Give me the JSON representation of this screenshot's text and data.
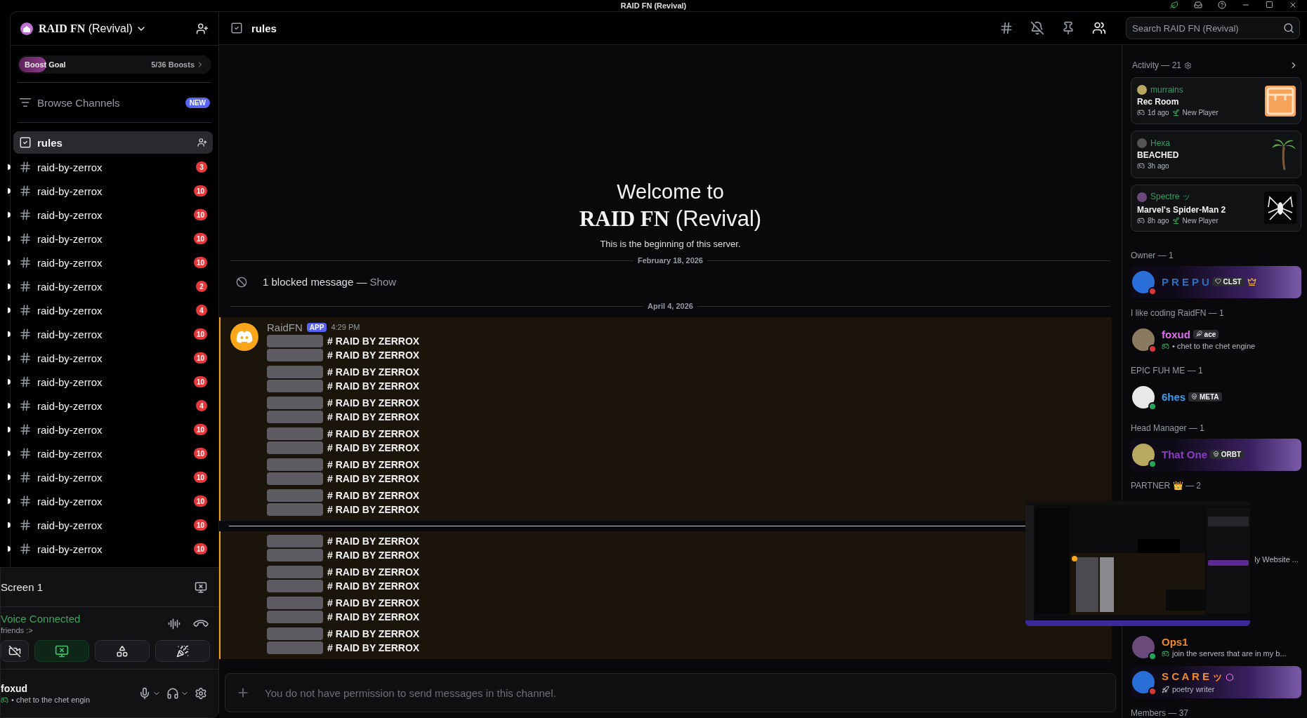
{
  "window": {
    "title": "RAID FN (Revival)"
  },
  "server": {
    "name": "**RAID FN** (Revival)",
    "boost": {
      "label": "Boost Goal",
      "count": "5/36 Boosts",
      "level": 0.14
    },
    "browse": {
      "label": "Browse Channels",
      "badge": "NEW"
    }
  },
  "channels": [
    {
      "kind": "rules",
      "name": "rules",
      "selected": true,
      "unread": false
    },
    {
      "kind": "text",
      "name": "raid-by-zerrox",
      "badge": "3",
      "selected": false,
      "unread": true
    },
    {
      "kind": "text",
      "name": "raid-by-zerrox",
      "badge": "10",
      "selected": false,
      "unread": true
    },
    {
      "kind": "text",
      "name": "raid-by-zerrox",
      "badge": "10",
      "selected": false,
      "unread": true
    },
    {
      "kind": "text",
      "name": "raid-by-zerrox",
      "badge": "10",
      "selected": false,
      "unread": true
    },
    {
      "kind": "text",
      "name": "raid-by-zerrox",
      "badge": "10",
      "selected": false,
      "unread": true
    },
    {
      "kind": "text",
      "name": "raid-by-zerrox",
      "badge": "2",
      "selected": false,
      "unread": true
    },
    {
      "kind": "text",
      "name": "raid-by-zerrox",
      "badge": "4",
      "selected": false,
      "unread": true
    },
    {
      "kind": "text",
      "name": "raid-by-zerrox",
      "badge": "10",
      "selected": false,
      "unread": true
    },
    {
      "kind": "text",
      "name": "raid-by-zerrox",
      "badge": "10",
      "selected": false,
      "unread": true
    },
    {
      "kind": "text",
      "name": "raid-by-zerrox",
      "badge": "10",
      "selected": false,
      "unread": true
    },
    {
      "kind": "text",
      "name": "raid-by-zerrox",
      "badge": "4",
      "selected": false,
      "unread": true
    },
    {
      "kind": "text",
      "name": "raid-by-zerrox",
      "badge": "10",
      "selected": false,
      "unread": true
    },
    {
      "kind": "text",
      "name": "raid-by-zerrox",
      "badge": "10",
      "selected": false,
      "unread": true
    },
    {
      "kind": "text",
      "name": "raid-by-zerrox",
      "badge": "10",
      "selected": false,
      "unread": true
    },
    {
      "kind": "text",
      "name": "raid-by-zerrox",
      "badge": "10",
      "selected": false,
      "unread": true
    },
    {
      "kind": "text",
      "name": "raid-by-zerrox",
      "badge": "10",
      "selected": false,
      "unread": true
    },
    {
      "kind": "text",
      "name": "raid-by-zerrox",
      "badge": "10",
      "selected": false,
      "unread": true
    }
  ],
  "voice": {
    "stream": "Screen 1",
    "status": "Voice Connected",
    "channel": "friends :>",
    "buttons": [
      {
        "kind": "camera",
        "on": false
      },
      {
        "kind": "screen",
        "on": true
      },
      {
        "kind": "activities",
        "on": false
      },
      {
        "kind": "soundboard",
        "on": false
      }
    ]
  },
  "user": {
    "name": "foxud",
    "status": "• chet to the chet engin"
  },
  "header": {
    "channel": "rules",
    "tools": [
      {
        "kind": "threads",
        "on": false
      },
      {
        "kind": "mute",
        "on": false
      },
      {
        "kind": "pins",
        "on": false
      },
      {
        "kind": "members",
        "on": true
      }
    ],
    "search": {
      "placeholder": "Search RAID FN (Revival)"
    }
  },
  "welcome": {
    "line1": "Welcome to",
    "line2": "**RAID FN** (Revival)",
    "subtitle": "This is the beginning of this server."
  },
  "dates": [
    "February 18, 2026",
    "April 4, 2026"
  ],
  "blocked": {
    "text": "1 blocked message —",
    "link": "Show"
  },
  "message": {
    "author": "RaidFN",
    "tag": "APP",
    "time": "4:29 PM",
    "lines": [
      "# RAID BY ZERROX",
      "# RAID BY ZERROX",
      "# RAID BY ZERROX",
      "# RAID BY ZERROX",
      "# RAID BY ZERROX",
      "# RAID BY ZERROX",
      "# RAID BY ZERROX",
      "# RAID BY ZERROX",
      "# RAID BY ZERROX",
      "# RAID BY ZERROX",
      "# RAID BY ZERROX",
      "# RAID BY ZERROX"
    ],
    "more_lines": [
      "# RAID BY ZERROX",
      "# RAID BY ZERROX",
      "# RAID BY ZERROX",
      "# RAID BY ZERROX",
      "# RAID BY ZERROX",
      "# RAID BY ZERROX",
      "# RAID BY ZERROX",
      "# RAID BY ZERROX"
    ]
  },
  "composer": {
    "placeholder": "You do not have permission to send messages in this channel."
  },
  "activity": {
    "title": "Activity — 21",
    "cards": [
      {
        "kind": "recroom",
        "user": "murrains",
        "game": "Rec Room",
        "ago": "1d ago",
        "note": "New Player"
      },
      {
        "kind": "palm",
        "user": "Hexa",
        "game": "BEACHED",
        "ago": "3h ago"
      },
      {
        "kind": "spider",
        "user": "Spectre ッ",
        "game": "Marvel's Spider-Man 2",
        "ago": "8h ago",
        "note": "New Player"
      }
    ]
  },
  "groups": [
    {
      "title": "Owner — 1",
      "members": [
        {
          "name": "P R E P U",
          "tag": "CLST",
          "color": "#2f6fb8",
          "dnd": true,
          "banner": true,
          "crown": true
        }
      ]
    },
    {
      "title": "I like coding RaidFN — 1",
      "members": [
        {
          "name": "foxud",
          "tag": "ace",
          "color": "#e070f0",
          "dnd": true,
          "banner": false,
          "activity": "• chet to the chet engine"
        }
      ]
    },
    {
      "title": "EPIC FUH ME — 1",
      "members": [
        {
          "name": "6hes",
          "tag": "META",
          "color": "#3a9df0",
          "dnd": false,
          "banner": false
        }
      ]
    },
    {
      "title": "Head Manager — 1",
      "members": [
        {
          "name": "That One",
          "tag": "ORBT",
          "color": "#8a3fc0",
          "dnd": false,
          "banner": true
        }
      ]
    },
    {
      "title": "PARTNER 👑 — 2",
      "members": [
        {
          "activity": "ly Website ...",
          "hidden": true
        }
      ]
    },
    {
      "members": [
        {
          "name": "Ops1",
          "color": "#f08a24",
          "dnd": false,
          "banner": false,
          "activity": "join the servers that are in my b..."
        },
        {
          "name": "S C A R E ッ",
          "color": "#f08a24",
          "dnd": true,
          "banner": true,
          "activity": "poetry writer"
        }
      ]
    },
    {
      "title": "Members — 37"
    }
  ],
  "stream_preview": {
    "kind": "picture"
  }
}
